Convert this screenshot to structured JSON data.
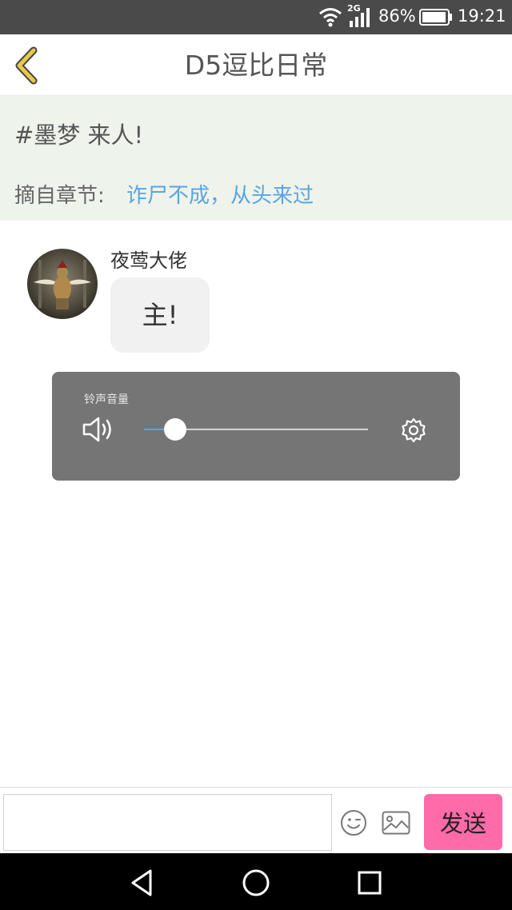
{
  "status_bar": {
    "network_type": "2G",
    "battery_percent": "86%",
    "time": "19:21",
    "icons": [
      "wifi-icon",
      "signal-icon",
      "battery-icon"
    ]
  },
  "header": {
    "title": "D5逗比日常",
    "back_icon": "chevron-left-icon",
    "back_icon_color": "#e8c84a"
  },
  "topic": {
    "title": "#墨梦 来人!",
    "source_label": "摘自章节:",
    "source_link": "诈尸不成，从头来过",
    "link_color": "#5aa5de"
  },
  "messages": [
    {
      "username": "夜莺大佬",
      "text": "主!"
    }
  ],
  "volume_panel": {
    "label": "铃声音量",
    "level": 0.14,
    "icons": [
      "speaker-icon",
      "settings-icon"
    ]
  },
  "input_bar": {
    "value": "",
    "send_label": "发送",
    "send_color": "#ff6aa8",
    "icons": [
      "emoji-icon",
      "image-icon"
    ]
  },
  "nav_bar": {
    "icons": [
      "back-triangle-icon",
      "home-circle-icon",
      "recents-square-icon"
    ]
  }
}
